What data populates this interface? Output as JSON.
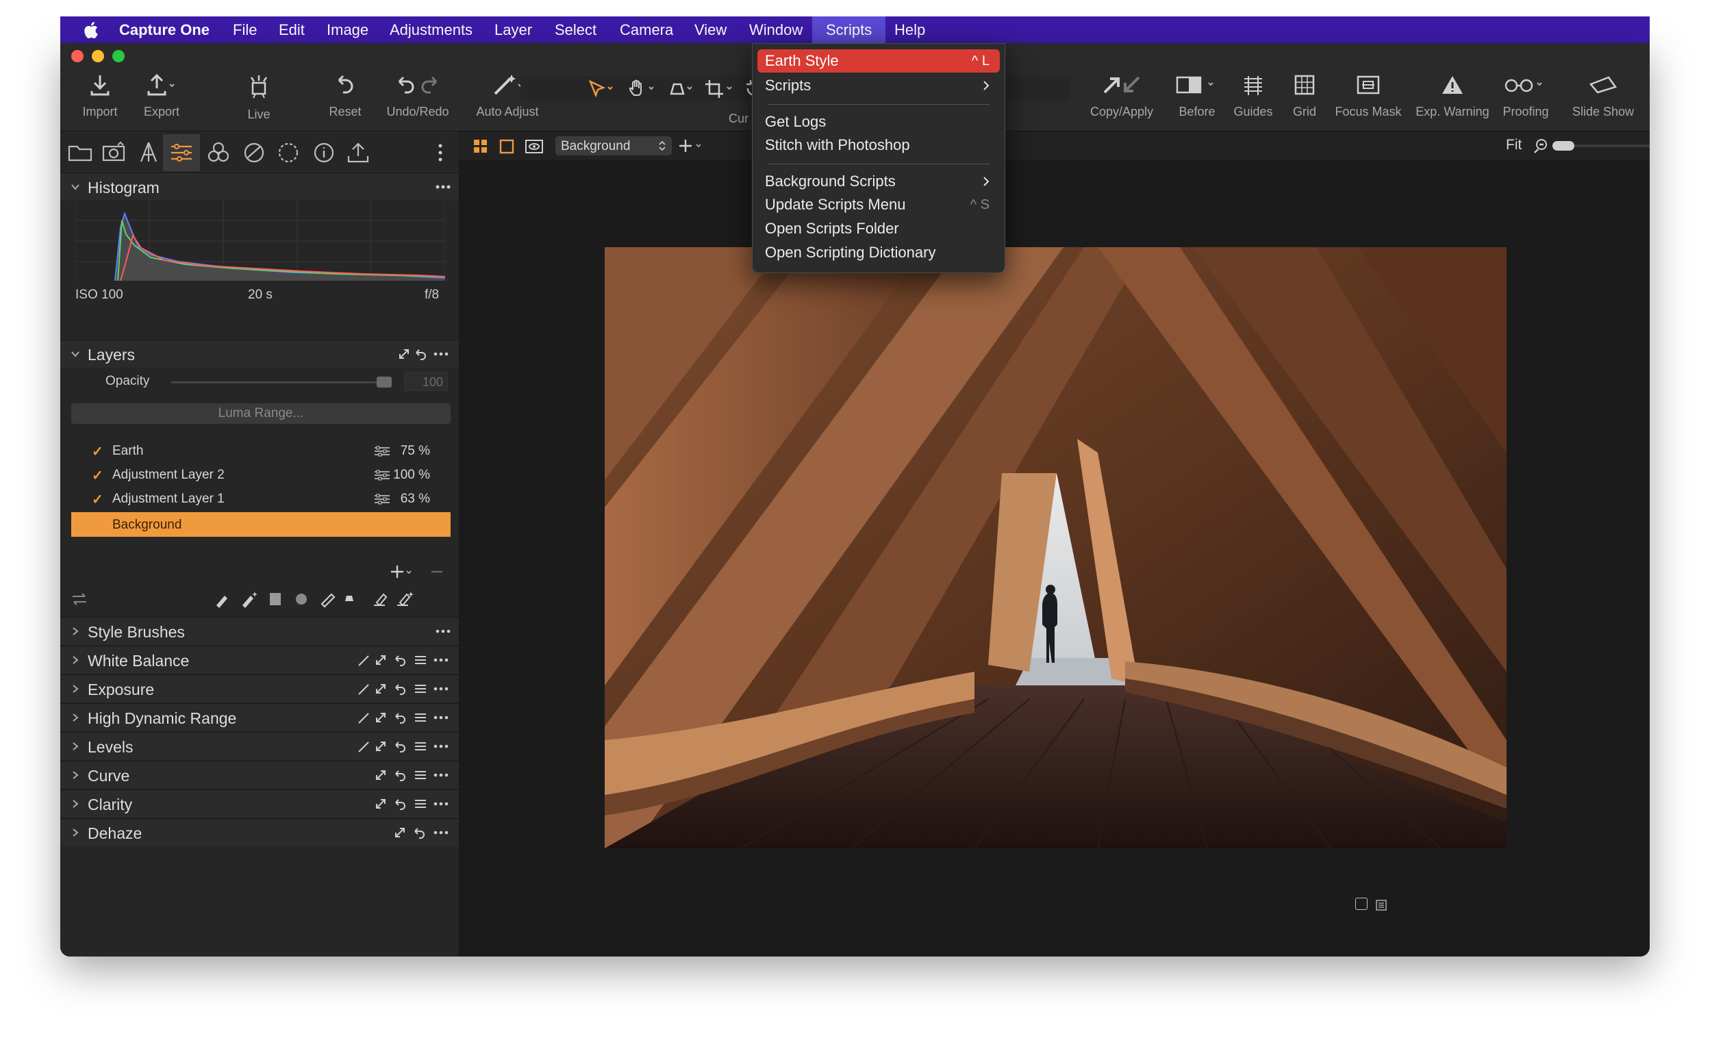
{
  "menubar": {
    "app_name": "Capture One",
    "items": [
      "File",
      "Edit",
      "Image",
      "Adjustments",
      "Layer",
      "Select",
      "Camera",
      "View",
      "Window",
      "Scripts",
      "Help"
    ],
    "active": "Scripts"
  },
  "toolbar": {
    "left": [
      {
        "label": "Import",
        "icon": "import-icon"
      },
      {
        "label": "Export",
        "icon": "export-icon"
      },
      {
        "label": "Live",
        "icon": "live-icon"
      },
      {
        "label": "Reset",
        "icon": "reset-icon"
      },
      {
        "label": "Undo/Redo",
        "icon": "undo-redo-icon"
      },
      {
        "label": "Auto Adjust",
        "icon": "auto-adjust-icon"
      }
    ],
    "cursor_label_fragment": "Cur",
    "right": [
      {
        "label": "Copy/Apply",
        "icon": "copy-apply-icon"
      },
      {
        "label": "Before",
        "icon": "before-icon"
      },
      {
        "label": "Guides",
        "icon": "guides-icon"
      },
      {
        "label": "Grid",
        "icon": "grid-icon"
      },
      {
        "label": "Focus Mask",
        "icon": "focus-mask-icon"
      },
      {
        "label": "Exp. Warning",
        "icon": "exposure-warning-icon"
      },
      {
        "label": "Proofing",
        "icon": "proofing-icon"
      },
      {
        "label": "Slide Show",
        "icon": "slide-show-icon"
      }
    ]
  },
  "histogram": {
    "title": "Histogram",
    "iso": "ISO 100",
    "shutter": "20 s",
    "aperture": "f/8"
  },
  "layers": {
    "title": "Layers",
    "opacity_label": "Opacity",
    "opacity_value": "100",
    "luma_range": "Luma Range...",
    "items": [
      {
        "name": "Earth",
        "percent": "75 %",
        "checked": true
      },
      {
        "name": "Adjustment Layer 2",
        "percent": "100 %",
        "checked": true
      },
      {
        "name": "Adjustment Layer 1",
        "percent": "63 %",
        "checked": true
      },
      {
        "name": "Background",
        "percent": "",
        "checked": false,
        "selected": true
      }
    ]
  },
  "tools": [
    "Style Brushes",
    "White Balance",
    "Exposure",
    "High Dynamic Range",
    "Levels",
    "Curve",
    "Clarity",
    "Dehaze"
  ],
  "viewer": {
    "layer_select": "Background",
    "zoom_label": "Fit"
  },
  "scripts_menu": {
    "items": [
      {
        "label": "Earth Style",
        "shortcut": "^ L",
        "highlighted": true
      },
      {
        "label": "Scripts",
        "submenu": true
      },
      {
        "label": "Get Logs"
      },
      {
        "label": "Stitch with Photoshop"
      },
      {
        "label": "Background Scripts",
        "submenu": true
      },
      {
        "label": "Update Scripts Menu",
        "shortcut": "^ S"
      },
      {
        "label": "Open Scripts Folder"
      },
      {
        "label": "Open Scripting Dictionary"
      }
    ]
  },
  "colors": {
    "menubar_bg": "#3c1ba8",
    "accent_orange": "#f09a3e",
    "menu_highlight": "#d83b34",
    "panel_bg": "#262626",
    "viewer_bg": "#1b1b1b"
  }
}
